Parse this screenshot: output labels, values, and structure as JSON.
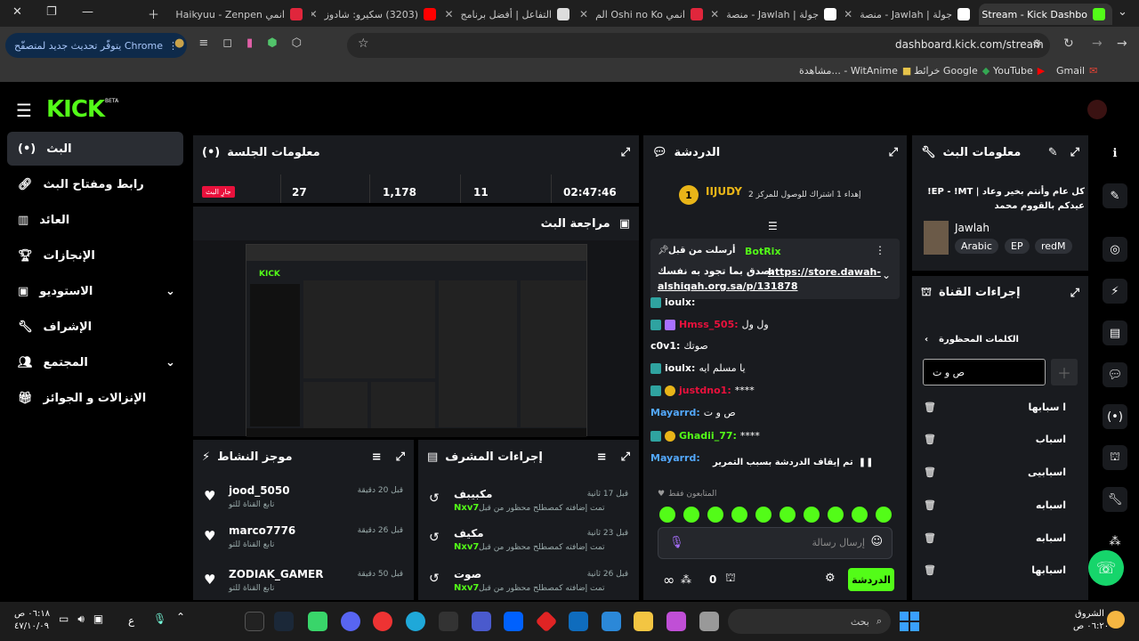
{
  "browser": {
    "tabs": [
      {
        "title": "Stream - Kick Dashbo",
        "active": true
      },
      {
        "title": "جولة | Jawlah - منصة"
      },
      {
        "title": "جولة | Jawlah - منصة"
      },
      {
        "title": "انمي Oshi no Ko الم"
      },
      {
        "title": "التفاعل | أفضل برنامج"
      },
      {
        "title": "(3203) سكيرو: شادوز"
      },
      {
        "title": "انمي Haikyuu - Zenpen"
      }
    ],
    "update_label": "يتوفّر تحديث جديد لمتصفّح Chrome",
    "url": "dashboard.kick.com/stream",
    "bookmarks": [
      "Gmail",
      "YouTube",
      "خرائط Google",
      "مشاهدة... - WitAnime"
    ]
  },
  "kick": {
    "logo": "KICK",
    "beta": "BETA",
    "nav": [
      {
        "label": "البث",
        "icon": "live-icon"
      },
      {
        "label": "رابط ومفتاح البث",
        "icon": "link-icon"
      },
      {
        "label": "العائد",
        "icon": "chart-icon"
      },
      {
        "label": "الإنجازات",
        "icon": "trophy-icon"
      },
      {
        "label": "الاستوديو",
        "icon": "studio-icon"
      },
      {
        "label": "الإشراف",
        "icon": "wrench-icon"
      },
      {
        "label": "المجتمع",
        "icon": "users-icon"
      },
      {
        "label": "الإنزالات و الجوائز",
        "icon": "gift-icon"
      }
    ],
    "session": {
      "title": "معلومات الجلسة",
      "live_badge": "جارِ البث",
      "stats": [
        "27",
        "1,178",
        "11",
        "02:47:46"
      ]
    },
    "preview": {
      "title": "مراجعة البث"
    },
    "activity": {
      "title": "موجز النشاط",
      "items": [
        {
          "user": "jood_5050",
          "text": "تابع القناة للتو",
          "time": "قبل 20 دقيقة"
        },
        {
          "user": "marco7776",
          "text": "تابع القناة للتو",
          "time": "قبل 26 دقيقة"
        },
        {
          "user": "ZODIAK_GAMER",
          "text": "تابع القناة للتو",
          "time": "قبل 50 دقيقة"
        }
      ]
    },
    "modactions": {
      "title": "إجراءات المشرف",
      "items": [
        {
          "word": "مكبيبف",
          "desc": "تمت إضافته كمصطلح محظور من قبل",
          "by": "Nxv7",
          "time": "قبل 17 ثانية"
        },
        {
          "word": "مكيف",
          "desc": "تمت إضافته كمصطلح محظور من قبل",
          "by": "Nxv7",
          "time": "قبل 23 ثانية"
        },
        {
          "word": "صوت",
          "desc": "تمت إضافته كمصطلح محظور من قبل",
          "by": "Nxv7",
          "time": "قبل 26 ثانية"
        }
      ]
    },
    "chat": {
      "title": "الدردشة",
      "top_user": "IIJUDY",
      "top_rank": "1",
      "top_text": "إهداء 1 اشتراك للوصول للمركز 2",
      "pinned_by": "أرسلت من قبل",
      "pinned_user": "BotRix",
      "pinned_text": "تصدق بما تجود به نفسك",
      "pinned_link": "https://store.dawah-alshiqah.org.sa/p/131878",
      "lines": [
        {
          "user": "ioulx:",
          "text": ""
        },
        {
          "user": "Hmss_505:",
          "text": "ول ول"
        },
        {
          "user": "c0v1:",
          "text": "صوتك"
        },
        {
          "user": "ioulx:",
          "text": "يا مسلم ايه"
        },
        {
          "user": "justdno1:",
          "text": "****"
        },
        {
          "user": "Mayarrd:",
          "text": "ص و ت"
        },
        {
          "user": "Ghadii_77:",
          "text": "****"
        },
        {
          "user": "Mayarrd:",
          "text": ""
        }
      ],
      "paused": "تم إيقاف الدردشة بسبب التمرير",
      "followers_only": "المتابعون فقط",
      "placeholder": "إرسال رسالة",
      "send_label": "الدردشة",
      "count": "0"
    },
    "streaminfo": {
      "title": "معلومات البث",
      "stream_title": "كل عام وأنتم بخير وعاد | EP - !MT! عيدكم بالقووم محمد",
      "category": "Jawlah",
      "tags": [
        "Arabic",
        "EP",
        "redM"
      ]
    },
    "channelactions": {
      "title": "إجراءات القناة",
      "section": "الكلمات المحظورة",
      "input_value": "ص و ت",
      "words": [
        "ا سبابها",
        "اسباب",
        "اسبابيى",
        "اسبابه",
        "اسبابه",
        "اسبابها"
      ]
    }
  },
  "taskbar": {
    "search_placeholder": "بحث",
    "time": "٠٦:١٨ ص",
    "date": "٤٧/١٠/٠٩",
    "weather_label": "الشروق",
    "weather_time": "٠٦:٢٠ ص",
    "lang": "ع"
  },
  "colors": {
    "accent": "#53fc18",
    "panel": "#191b1f",
    "live": "#e9113c"
  }
}
